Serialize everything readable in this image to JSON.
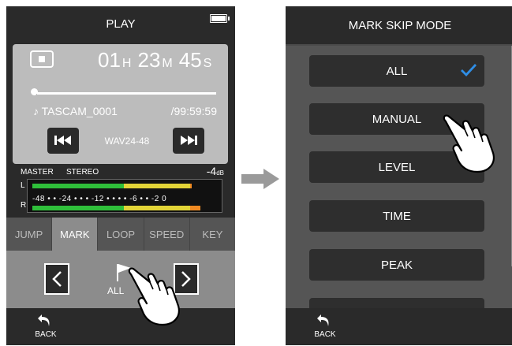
{
  "play_screen": {
    "title": "PLAY",
    "counter": {
      "hours": "01",
      "h_unit": "H",
      "minutes": "23",
      "m_unit": "M",
      "seconds": "45",
      "s_unit": "S"
    },
    "playback_progress": 0.02,
    "filename": "♪ TASCAM_0001",
    "remaining": "/99:59:59",
    "format": "WAV24-48",
    "meter": {
      "master_label": "MASTER",
      "stereo_label": "STEREO",
      "gain_value": "-4",
      "gain_unit": "dB",
      "left_label": "L",
      "right_label": "R",
      "scale": "-48 • • -24 • • • -12 • • • • -6 • • -2 0",
      "left_level": 0.87,
      "right_level": 0.92
    },
    "tabs": [
      {
        "label": "JUMP",
        "active": false
      },
      {
        "label": "MARK",
        "active": true
      },
      {
        "label": "LOOP",
        "active": false
      },
      {
        "label": "SPEED",
        "active": false
      },
      {
        "label": "KEY",
        "active": false
      }
    ],
    "mark_label": "ALL",
    "back_label": "BACK"
  },
  "mark_skip_screen": {
    "title": "MARK SKIP MODE",
    "options": [
      {
        "label": "ALL",
        "checked": true
      },
      {
        "label": "MANUAL",
        "checked": false
      },
      {
        "label": "LEVEL",
        "checked": false
      },
      {
        "label": "TIME",
        "checked": false
      },
      {
        "label": "PEAK",
        "checked": false
      },
      {
        "label": "",
        "checked": false
      }
    ],
    "back_label": "BACK"
  },
  "colors": {
    "screen_bg": "#2a2a2a",
    "panel_gray": "#bcbcbc",
    "tab_bg": "#555555",
    "active_tab": "#8c8c8c",
    "check_blue": "#2f8ee6",
    "meter_green": "#2fbf3a",
    "meter_yellow": "#e2d437",
    "meter_orange": "#f08a22",
    "transition_arrow": "#9a9a9a"
  },
  "icons": [
    "battery-icon",
    "stop-icon",
    "skip-back-icon",
    "skip-forward-icon",
    "chevron-left-icon",
    "chevron-right-icon",
    "flag-icon",
    "back-arrow-icon",
    "checkmark-icon",
    "pointing-hand-icon",
    "transition-arrow-icon"
  ]
}
